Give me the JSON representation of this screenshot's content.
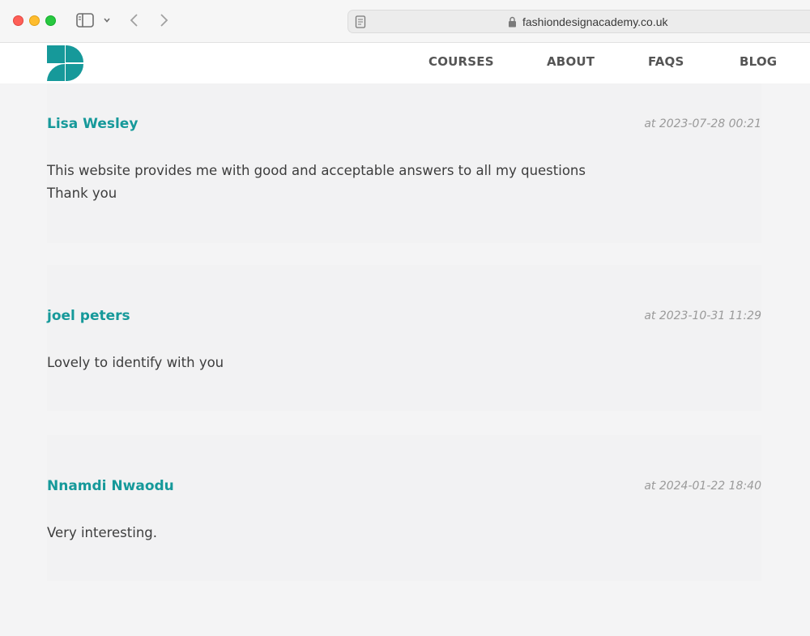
{
  "browser": {
    "url": "fashiondesignacademy.co.uk"
  },
  "nav": {
    "items": [
      {
        "label": "COURSES"
      },
      {
        "label": "ABOUT"
      },
      {
        "label": "FAQS"
      },
      {
        "label": "BLOG"
      }
    ]
  },
  "colors": {
    "brand_teal": "#16999a",
    "nav_text": "#555555",
    "timestamp": "#9a9a9a"
  },
  "comments": [
    {
      "author": "Lisa Wesley",
      "timestamp": "at 2023-07-28 00:21",
      "lines": [
        "This website provides me with good and acceptable answers to all my questions",
        "Thank you"
      ]
    },
    {
      "author": "joel peters",
      "timestamp": "at 2023-10-31 11:29",
      "lines": [
        "Lovely to identify with you"
      ]
    },
    {
      "author": "Nnamdi Nwaodu",
      "timestamp": "at 2024-01-22 18:40",
      "lines": [
        "Very interesting."
      ]
    }
  ]
}
